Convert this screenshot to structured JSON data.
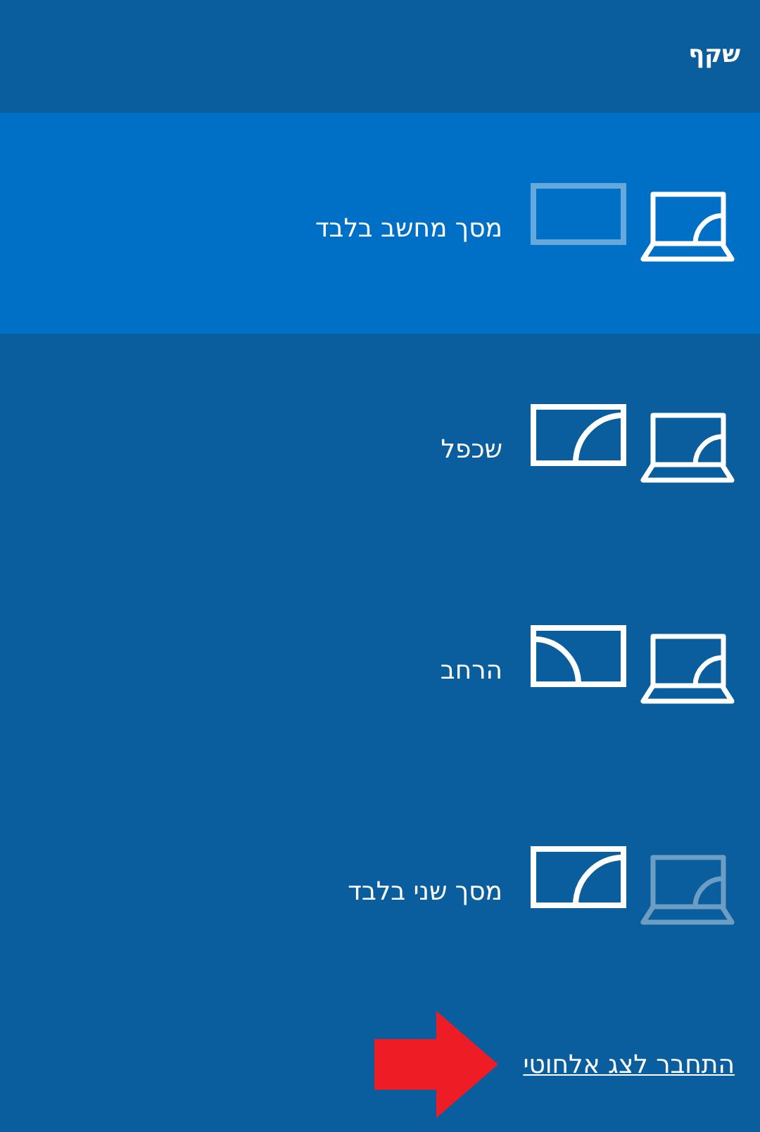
{
  "title": "שקף",
  "options": [
    {
      "label": "מסך מחשב בלבד",
      "kind": "pc_only",
      "selected": true
    },
    {
      "label": "שכפל",
      "kind": "duplicate",
      "selected": false
    },
    {
      "label": "הרחב",
      "kind": "extend",
      "selected": false
    },
    {
      "label": "מסך שני בלבד",
      "kind": "second_only",
      "selected": false
    }
  ],
  "link": "התחבר לצג אלחוטי"
}
